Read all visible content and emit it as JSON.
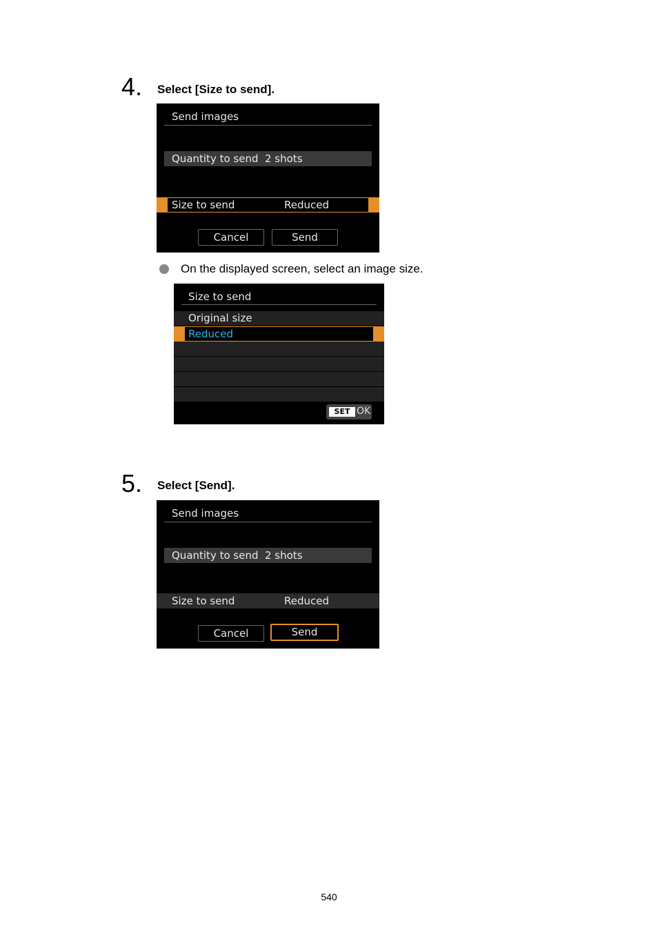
{
  "step4": {
    "number": "4.",
    "title": "Select [Size to send].",
    "screen": {
      "title": "Send images",
      "quantity_label": "Quantity to send",
      "quantity_value": "2 shots",
      "size_label": "Size to send",
      "size_value": "Reduced",
      "cancel_label": "Cancel",
      "send_label": "Send"
    },
    "bullet": "On the displayed screen, select an image size.",
    "size_screen": {
      "title": "Size to send",
      "options": [
        "Original size",
        "Reduced"
      ],
      "selected": "Reduced",
      "set_label": "SET",
      "ok_label": "OK"
    }
  },
  "step5": {
    "number": "5.",
    "title": "Select [Send].",
    "screen": {
      "title": "Send images",
      "quantity_label": "Quantity to send",
      "quantity_value": "2 shots",
      "size_label": "Size to send",
      "size_value": "Reduced",
      "cancel_label": "Cancel",
      "send_label": "Send"
    }
  },
  "colors": {
    "highlight": "#e58e2a",
    "selected_text": "#2ab4e8"
  },
  "page_number": "540"
}
